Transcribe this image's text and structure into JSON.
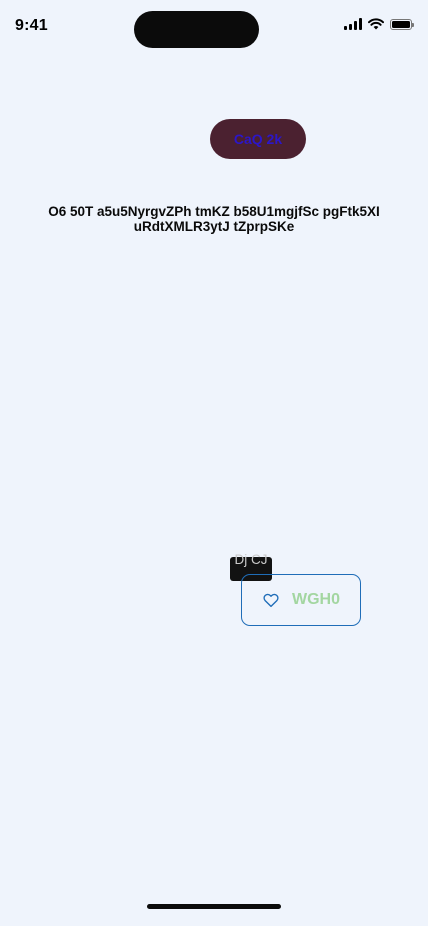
{
  "status_bar": {
    "time": "9:41",
    "icons": [
      "cellular-signal-icon",
      "wifi-icon",
      "battery-icon"
    ]
  },
  "top_button": {
    "label": "CaQ 2k",
    "background": "#4B2130",
    "text_color": "#2C16C9"
  },
  "headline": {
    "text": "O6 50T a5u5NyrgvZPh tmKZ b58U1mgjfSc pgFtk5XI uRdtXMLR3ytJ tZprpSKe"
  },
  "tooltip": {
    "text": "Dj CJ"
  },
  "favorite_button": {
    "label": "WGH0",
    "icon": "heart-icon",
    "border_color": "#1F6DB8",
    "label_color": "#A3D6A1"
  },
  "colors": {
    "background": "#EFF4FC"
  }
}
